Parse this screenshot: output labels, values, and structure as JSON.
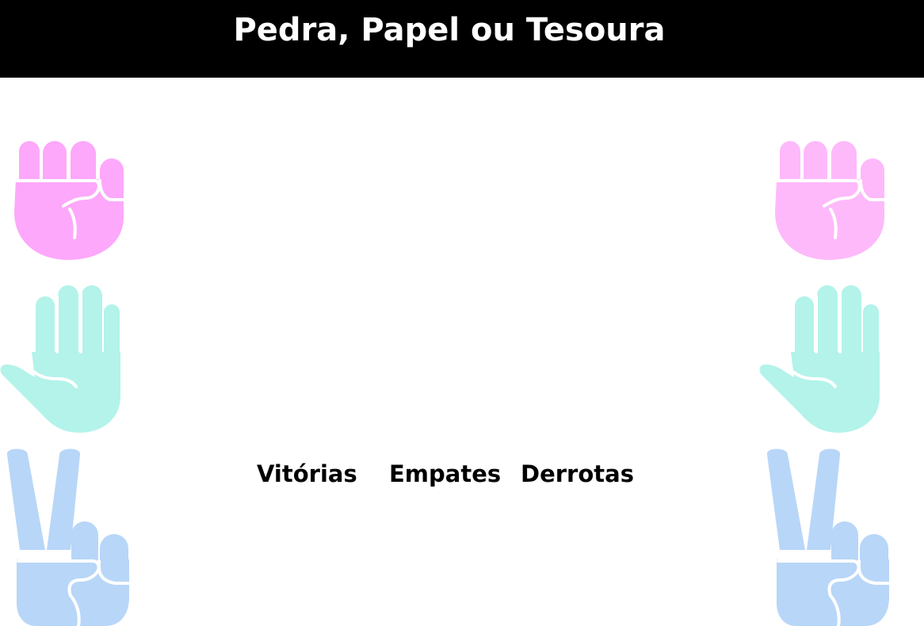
{
  "header": {
    "title": "Pedra, Papel ou Tesoura"
  },
  "player": {
    "choices": [
      {
        "name": "pedra",
        "icon": "rock-fist-icon",
        "color": "#FDA8FA"
      },
      {
        "name": "papel",
        "icon": "paper-hand-icon",
        "color": "#B3F3EA"
      },
      {
        "name": "tesoura",
        "icon": "scissors-victory-hand-icon",
        "color": "#B8D6F8"
      }
    ]
  },
  "computer": {
    "choices": [
      {
        "name": "pedra",
        "icon": "rock-fist-icon",
        "color": "#FEB9FB"
      },
      {
        "name": "papel",
        "icon": "paper-hand-icon",
        "color": "#B3F3EA"
      },
      {
        "name": "tesoura",
        "icon": "scissors-victory-hand-icon",
        "color": "#B8D6F8"
      }
    ]
  },
  "scoreboard": {
    "wins_label": "Vitórias",
    "draws_label": "Empates",
    "losses_label": "Derrotas"
  }
}
